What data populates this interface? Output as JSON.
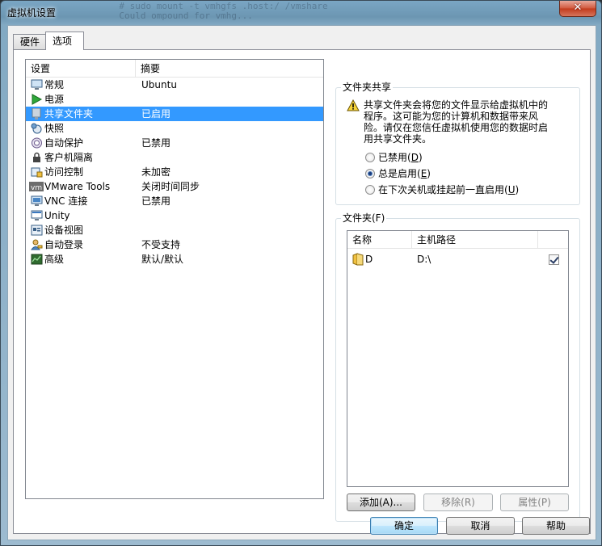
{
  "window": {
    "title": "虚拟机设置",
    "close_label": "✕",
    "ghost_text": "       # sudo mount -t vmhgfs .host:/ /vmshare\n       Could ompound for vmhg..."
  },
  "tabs": [
    {
      "label": "硬件"
    },
    {
      "label": "选项"
    }
  ],
  "settings_list": {
    "header": {
      "col1": "设置",
      "col2": "摘要"
    },
    "rows": [
      {
        "name": "常规",
        "summary": "Ubuntu",
        "icon": "monitor-icon"
      },
      {
        "name": "电源",
        "summary": "",
        "icon": "play-icon"
      },
      {
        "name": "共享文件夹",
        "summary": "已启用",
        "icon": "shared-folder-icon"
      },
      {
        "name": "快照",
        "summary": "",
        "icon": "snapshot-icon"
      },
      {
        "name": "自动保护",
        "summary": "已禁用",
        "icon": "autoprotect-icon"
      },
      {
        "name": "客户机隔离",
        "summary": "",
        "icon": "lock-icon"
      },
      {
        "name": "访问控制",
        "summary": "未加密",
        "icon": "access-control-icon"
      },
      {
        "name": "VMware Tools",
        "summary": "关闭时间同步",
        "icon": "vmware-tools-icon"
      },
      {
        "name": "VNC 连接",
        "summary": "已禁用",
        "icon": "vnc-icon"
      },
      {
        "name": "Unity",
        "summary": "",
        "icon": "unity-icon"
      },
      {
        "name": "设备视图",
        "summary": "",
        "icon": "device-view-icon"
      },
      {
        "name": "自动登录",
        "summary": "不受支持",
        "icon": "autologin-icon"
      },
      {
        "name": "高级",
        "summary": "默认/默认",
        "icon": "advanced-icon"
      }
    ],
    "selected_index": 2
  },
  "sharing": {
    "group_label": "文件夹共享",
    "warning": "共享文件夹会将您的文件显示给虚拟机中的程序。这可能为您的计算机和数据带来风险。请仅在您信任虚拟机使用您的数据时启用共享文件夹。",
    "options": [
      {
        "label": "已禁用",
        "key": "D",
        "checked": false
      },
      {
        "label": "总是启用",
        "key": "E",
        "checked": true
      },
      {
        "label": "在下次关机或挂起前一直启用",
        "key": "U",
        "checked": false
      }
    ]
  },
  "folders": {
    "group_label": "文件夹(F)",
    "headers": {
      "name": "名称",
      "path": "主机路径"
    },
    "rows": [
      {
        "name": "D",
        "path": "D:\\",
        "enabled": true
      }
    ],
    "buttons": {
      "add": "添加(A)...",
      "remove": "移除(R)",
      "properties": "属性(P)"
    }
  },
  "footer": {
    "ok": "确定",
    "cancel": "取消",
    "help": "帮助"
  }
}
